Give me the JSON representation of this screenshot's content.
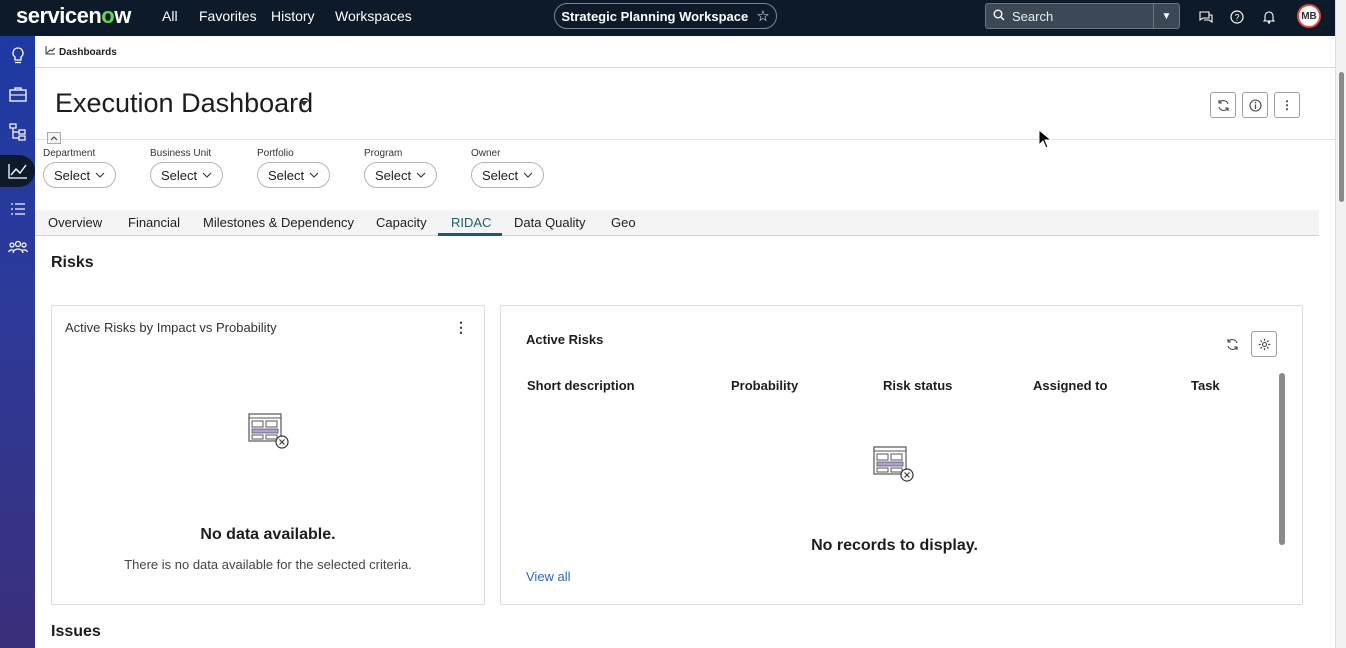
{
  "nav": {
    "logo_pre": "servicen",
    "logo_o": "o",
    "logo_post": "w",
    "links": [
      "All",
      "Favorites",
      "History",
      "Workspaces"
    ],
    "workspace": "Strategic Planning Workspace",
    "search_placeholder": "Search",
    "avatar_initials": "MB"
  },
  "breadcrumb": "Dashboards",
  "page_title": "Execution Dashboard",
  "filters": [
    {
      "label": "Department",
      "value": "Select"
    },
    {
      "label": "Business Unit",
      "value": "Select"
    },
    {
      "label": "Portfolio",
      "value": "Select"
    },
    {
      "label": "Program",
      "value": "Select"
    },
    {
      "label": "Owner",
      "value": "Select"
    }
  ],
  "tabs": [
    "Overview",
    "Financial",
    "Milestones & Dependency",
    "Capacity",
    "RIDAC",
    "Data Quality",
    "Geo"
  ],
  "active_tab": "RIDAC",
  "sections": {
    "risks": "Risks",
    "issues": "Issues"
  },
  "chart_card": {
    "title": "Active Risks by Impact vs Probability",
    "nodata_head": "No data available.",
    "nodata_sub": "There is no data available for the selected criteria."
  },
  "list_card": {
    "title": "Active Risks",
    "columns": [
      "Short description",
      "Probability",
      "Risk status",
      "Assigned to",
      "Task"
    ],
    "empty": "No records to display.",
    "view_all": "View all"
  },
  "colors": {
    "navbar": "#0c1a2a",
    "accent": "#1d5d69",
    "link": "#2d6bb5",
    "logo_green": "#62d84e"
  }
}
